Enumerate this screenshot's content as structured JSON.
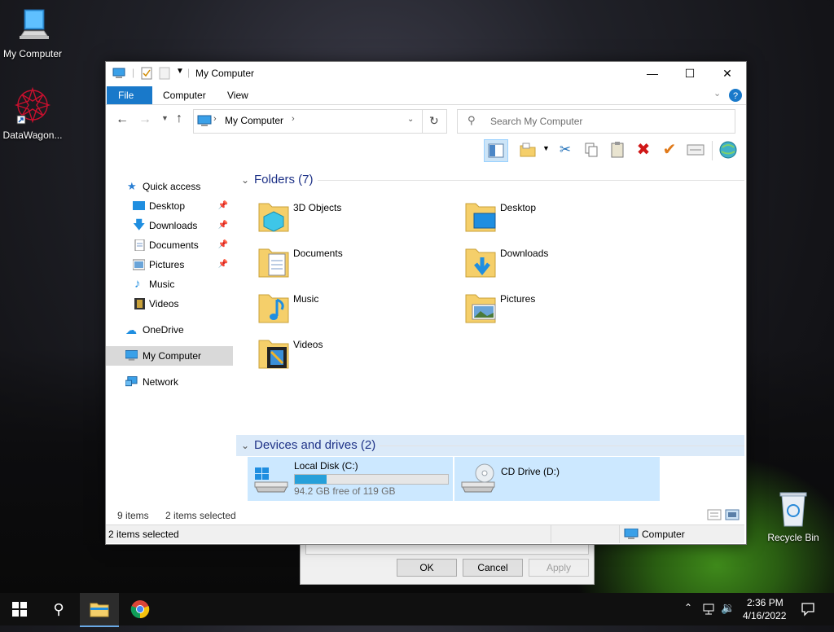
{
  "desktop": {
    "icons": [
      {
        "label": "My Computer"
      },
      {
        "label": "DataWagon..."
      },
      {
        "label": "Recycle Bin"
      }
    ]
  },
  "dialog": {
    "ok": "OK",
    "cancel": "Cancel",
    "apply": "Apply"
  },
  "window": {
    "title": "My Computer",
    "tabs": [
      "File",
      "Computer",
      "View"
    ],
    "address": {
      "path": "My Computer"
    },
    "search": {
      "placeholder": "Search My Computer"
    },
    "nav": {
      "quick_access": "Quick access",
      "items": [
        {
          "label": "Desktop",
          "pinned": true
        },
        {
          "label": "Downloads",
          "pinned": true
        },
        {
          "label": "Documents",
          "pinned": true
        },
        {
          "label": "Pictures",
          "pinned": true
        },
        {
          "label": "Music",
          "pinned": false
        },
        {
          "label": "Videos",
          "pinned": false
        }
      ],
      "onedrive": "OneDrive",
      "mycomputer": "My Computer",
      "network": "Network"
    },
    "folders_header": "Folders (7)",
    "folders": [
      {
        "name": "3D Objects"
      },
      {
        "name": "Desktop"
      },
      {
        "name": "Documents"
      },
      {
        "name": "Downloads"
      },
      {
        "name": "Music"
      },
      {
        "name": "Pictures"
      },
      {
        "name": "Videos"
      }
    ],
    "drives_header": "Devices and drives (2)",
    "drives": [
      {
        "name": "Local Disk (C:)",
        "free": "94.2 GB free of 119 GB",
        "used_fraction": 0.21
      },
      {
        "name": "CD Drive (D:)"
      }
    ],
    "status": {
      "items": "9 items",
      "selected": "2 items selected"
    },
    "bottom": {
      "selected": "2 items selected",
      "location": "Computer"
    }
  },
  "taskbar": {
    "time": "2:36 PM",
    "date": "4/16/2022"
  },
  "colors": {
    "accent": "#1979ca",
    "selection": "#cce8ff",
    "header_blue": "#1e3287"
  }
}
